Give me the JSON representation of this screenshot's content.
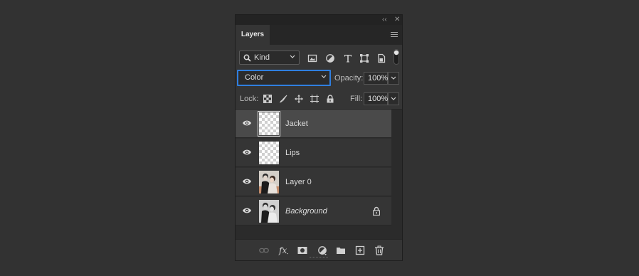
{
  "panel": {
    "title_controls": {
      "collapse": "‹‹",
      "close": "✕"
    },
    "tab_label": "Layers",
    "menu_icon": "panel-menu-icon"
  },
  "filter": {
    "kind_label": "Kind",
    "icons": [
      "pixel-filter-icon",
      "adjustment-filter-icon",
      "type-filter-icon",
      "shape-filter-icon",
      "smart-object-filter-icon",
      "filter-toggle-icon"
    ]
  },
  "blend": {
    "mode": "Color",
    "opacity_label": "Opacity:",
    "opacity_value": "100%",
    "accent": "#2f7fe0"
  },
  "lock": {
    "label": "Lock:",
    "icons": [
      "lock-transparent-icon",
      "lock-image-icon",
      "lock-position-icon",
      "lock-artboard-icon",
      "lock-all-icon"
    ],
    "fill_label": "Fill:",
    "fill_value": "100%"
  },
  "layers": [
    {
      "name": "Jacket",
      "selected": true,
      "thumb": "transparent",
      "italic": false,
      "locked": false
    },
    {
      "name": "Lips",
      "selected": false,
      "thumb": "transparent",
      "italic": false,
      "locked": false
    },
    {
      "name": "Layer 0",
      "selected": false,
      "thumb": "photo",
      "italic": false,
      "locked": false
    },
    {
      "name": "Background",
      "selected": false,
      "thumb": "photo",
      "italic": true,
      "locked": true
    }
  ],
  "footer_icons": [
    "link-layers-icon",
    "fx-icon",
    "add-mask-icon",
    "adjustment-layer-icon",
    "group-folder-icon",
    "new-layer-icon",
    "trash-icon"
  ]
}
